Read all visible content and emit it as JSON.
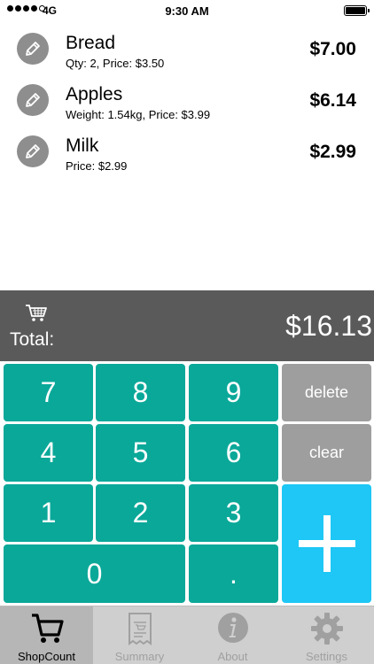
{
  "status_bar": {
    "carrier": "4G",
    "time": "9:30 AM",
    "battery_level": 1.0
  },
  "items": [
    {
      "name": "Bread",
      "detail": "Qty: 2, Price: $3.50",
      "price": "$7.00"
    },
    {
      "name": "Apples",
      "detail": "Weight: 1.54kg, Price: $3.99",
      "price": "$6.14"
    },
    {
      "name": "Milk",
      "detail": "Price: $2.99",
      "price": "$2.99"
    }
  ],
  "total": {
    "label": "Total:",
    "value": "$16.13",
    "icon": "cart-icon"
  },
  "keypad": {
    "keys": {
      "k7": "7",
      "k8": "8",
      "k9": "9",
      "k4": "4",
      "k5": "5",
      "k6": "6",
      "k1": "1",
      "k2": "2",
      "k3": "3",
      "k0": "0",
      "dot": ".",
      "delete": "delete",
      "clear": "clear"
    },
    "colors": {
      "number": "#0aa899",
      "function": "#9e9e9e",
      "plus": "#1ec7f5"
    }
  },
  "tabs": [
    {
      "label": "ShopCount",
      "icon": "cart-icon",
      "active": true
    },
    {
      "label": "Summary",
      "icon": "receipt-icon",
      "active": false
    },
    {
      "label": "About",
      "icon": "info-icon",
      "active": false
    },
    {
      "label": "Settings",
      "icon": "gear-icon",
      "active": false
    }
  ]
}
